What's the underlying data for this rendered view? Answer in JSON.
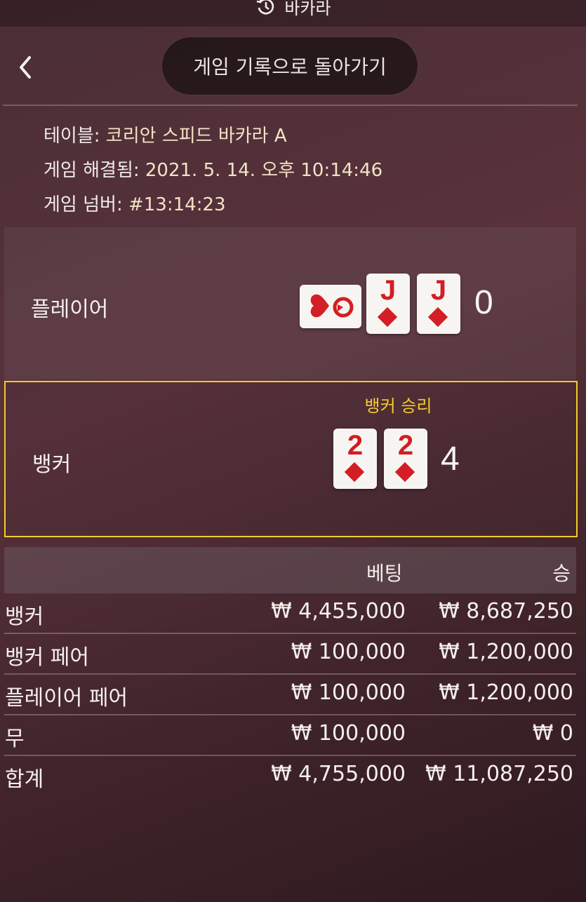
{
  "top_bar": {
    "title": "바카라",
    "icon": "history-icon"
  },
  "back_button": {
    "icon": "chevron-left-icon"
  },
  "back_to_history_label": "게임 기록으로 돌아가기",
  "info": {
    "table_label": "테이블:",
    "table_value": "코리안 스피드 바카라 A",
    "resolved_label": "게임 해결됨:",
    "resolved_value": "2021. 5. 14. 오후 10:14:46",
    "number_label": "게임 넘버:",
    "number_value": "#13:14:23"
  },
  "player": {
    "label": "플레이어",
    "score": "0",
    "cards": [
      {
        "rank": "",
        "suit": "card-back",
        "face_down": true
      },
      {
        "rank": "J",
        "suit": "diamonds"
      },
      {
        "rank": "J",
        "suit": "diamonds"
      }
    ]
  },
  "banker": {
    "label": "뱅커",
    "score": "4",
    "win_label": "뱅커 승리",
    "cards": [
      {
        "rank": "2",
        "suit": "diamonds"
      },
      {
        "rank": "2",
        "suit": "diamonds"
      }
    ]
  },
  "bets_table": {
    "headers": {
      "bet": "베팅",
      "win": "승"
    },
    "rows": [
      {
        "label": "뱅커",
        "bet": "₩ 4,455,000",
        "win": "₩ 8,687,250"
      },
      {
        "label": "뱅커 페어",
        "bet": "₩ 100,000",
        "win": "₩ 1,200,000"
      },
      {
        "label": "플레이어 페어",
        "bet": "₩ 100,000",
        "win": "₩ 1,200,000"
      },
      {
        "label": "무",
        "bet": "₩ 100,000",
        "win": "₩ 0"
      }
    ],
    "total": {
      "label": "합계",
      "bet": "₩ 4,755,000",
      "win": "₩ 11,087,250"
    }
  },
  "colors": {
    "accent": "#f2cc2e",
    "card_red": "#d21e24",
    "info_value": "#f3e3c6"
  }
}
